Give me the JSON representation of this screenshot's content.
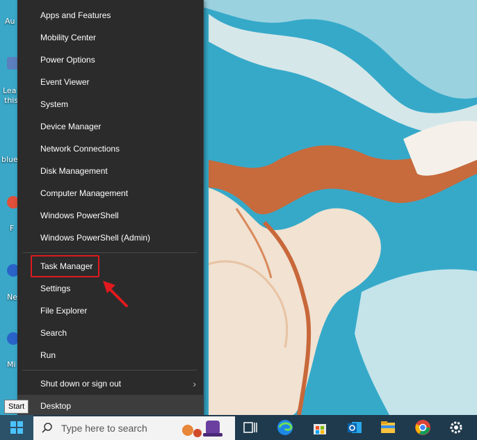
{
  "desktop": {
    "icon_labels": [
      "Au",
      "Lea",
      "this",
      "blue",
      "F",
      "Ne",
      "Mi"
    ]
  },
  "menu": {
    "items_top": [
      "Apps and Features",
      "Mobility Center",
      "Power Options",
      "Event Viewer",
      "System",
      "Device Manager",
      "Network Connections",
      "Disk Management",
      "Computer Management",
      "Windows PowerShell",
      "Windows PowerShell (Admin)"
    ],
    "items_mid": [
      "Task Manager",
      "Settings",
      "File Explorer",
      "Search",
      "Run"
    ],
    "items_bottom": [
      "Shut down or sign out",
      "Desktop"
    ]
  },
  "tooltip": "Start",
  "taskbar": {
    "search_placeholder": "Type here to search",
    "icons": [
      "start-icon",
      "search-icon",
      "task-view-icon",
      "edge-icon",
      "store-icon",
      "outlook-icon",
      "file-explorer-icon",
      "chrome-icon",
      "settings-icon"
    ]
  },
  "colors": {
    "menu_bg": "#2b2b2b",
    "highlight": "#e0191f",
    "water": "#2f9fc1",
    "taskbar": "#1f3a4d"
  }
}
